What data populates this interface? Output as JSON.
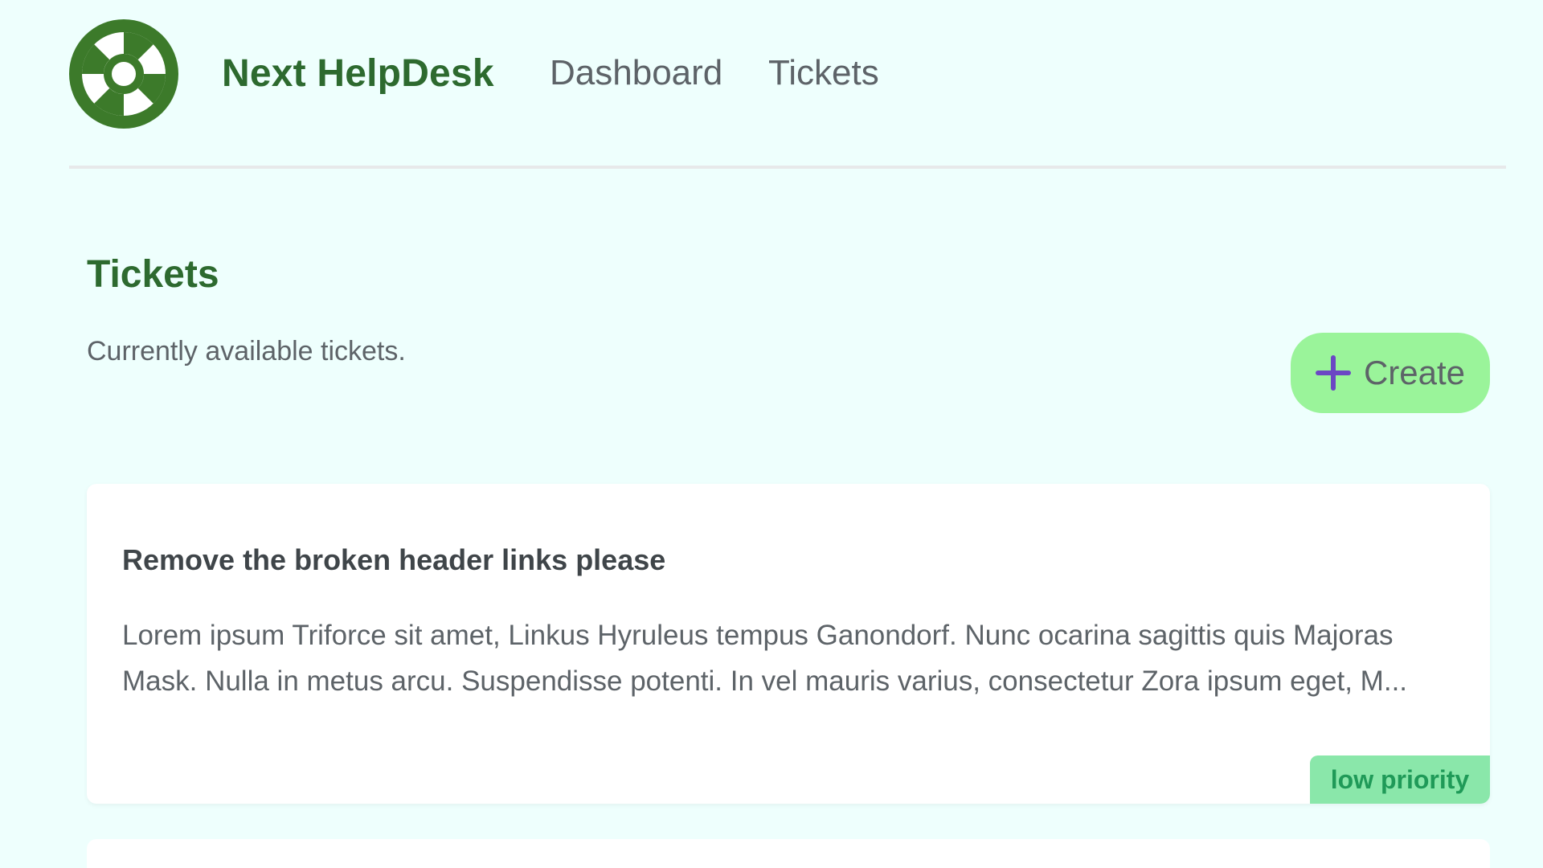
{
  "navbar": {
    "brand": "Next HelpDesk",
    "links": [
      {
        "label": "Dashboard"
      },
      {
        "label": "Tickets"
      }
    ],
    "logo_icon": "lifebuoy-icon"
  },
  "main": {
    "title": "Tickets",
    "subtitle": "Currently available tickets.",
    "create_button": {
      "label": "Create",
      "icon": "plus-icon"
    }
  },
  "tickets": [
    {
      "title": "Remove the broken header links please",
      "body": "Lorem ipsum Triforce sit amet, Linkus Hyruleus tempus Ganondorf. Nunc ocarina sagittis quis Majoras Mask. Nulla in metus arcu. Suspendisse potenti. In vel mauris varius, consectetur Zora ipsum eget, M...",
      "priority": "low priority"
    }
  ],
  "colors": {
    "background": "#eefffd",
    "brand": "#2d6a2f",
    "button_bg": "#9af49a",
    "plus_icon": "#6b47c4",
    "badge_bg": "#8ae7aa",
    "badge_text": "#1f9a58"
  }
}
